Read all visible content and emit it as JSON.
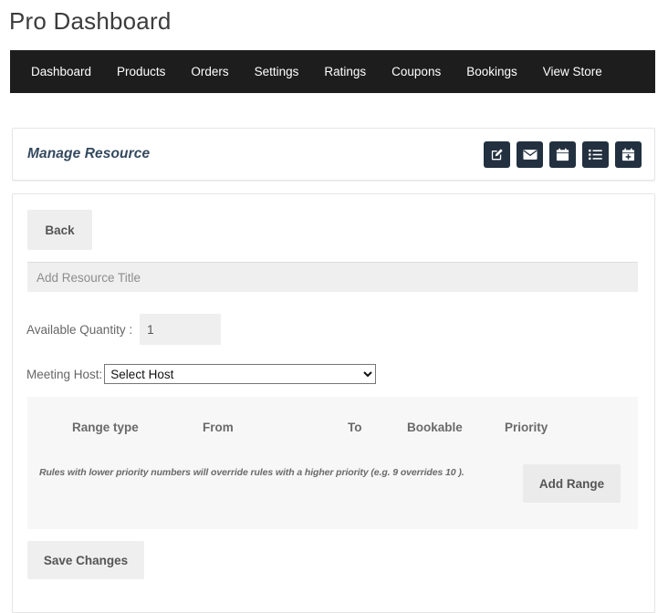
{
  "page": {
    "title": "Pro Dashboard"
  },
  "nav": {
    "items": [
      {
        "label": "Dashboard"
      },
      {
        "label": "Products"
      },
      {
        "label": "Orders"
      },
      {
        "label": "Settings"
      },
      {
        "label": "Ratings"
      },
      {
        "label": "Coupons"
      },
      {
        "label": "Bookings"
      },
      {
        "label": "View Store"
      }
    ]
  },
  "header": {
    "title": "Manage Resource",
    "icons": [
      {
        "name": "edit-pencil-square-icon"
      },
      {
        "name": "envelope-icon"
      },
      {
        "name": "calendar-icon"
      },
      {
        "name": "list-icon"
      },
      {
        "name": "calendar-plus-icon"
      }
    ]
  },
  "form": {
    "back_label": "Back",
    "resource_title_value": "",
    "resource_title_placeholder": "Add Resource Title",
    "quantity_label": "Available Quantity :",
    "quantity_value": "1",
    "host_label": "Meeting Host:",
    "host_selected": "Select Host",
    "host_options": [
      "Select Host"
    ],
    "save_label": "Save Changes"
  },
  "range_table": {
    "columns": [
      "Range type",
      "From",
      "To",
      "Bookable",
      "Priority"
    ],
    "rows": [],
    "note": "Rules with lower priority numbers will override rules with a higher priority (e.g. 9 overrides 10 ).",
    "add_range_label": "Add Range"
  },
  "colors": {
    "navbar_bg": "#1d1d1d",
    "icon_btn_bg": "#22303f",
    "panel_bg": "#ffffff",
    "field_bg": "#efefef",
    "table_bg": "#f7f7f7",
    "title_color": "#34495e"
  }
}
